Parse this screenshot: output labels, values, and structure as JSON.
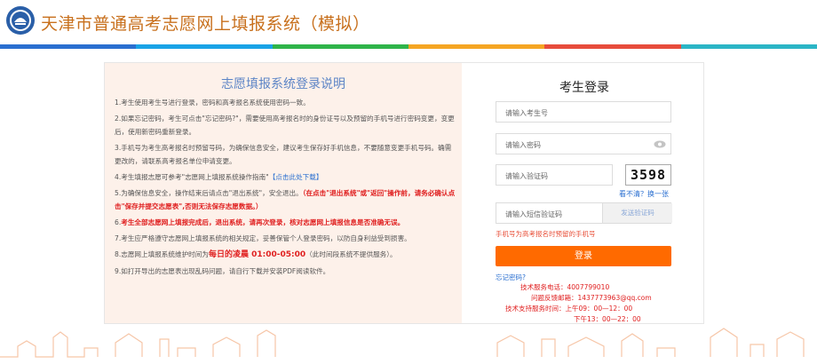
{
  "header": {
    "title": "天津市普通高考志愿网上填报系统（模拟）"
  },
  "colors": {
    "bar": [
      "#2a6fd0",
      "#1aa3e6",
      "#2fb44a",
      "#f5a623",
      "#e74c3c",
      "#2bb5c6"
    ],
    "accent": "#ff6a00"
  },
  "instructions": {
    "title": "志愿填报系统登录说明",
    "items": {
      "i1": "1.考生使用考生号进行登录，密码和高考报名系统使用密码一致。",
      "i2": "2.如果忘记密码，考生可点击\"忘记密码?\"，需要使用高考报名时的身份证号以及预留的手机号进行密码变更，变更后，使用新密码重新登录。",
      "i3": "3.手机号为考生高考报名时预留号码，为确保信息安全，建议考生保存好手机信息，不要随意变更手机号码。确需更改的，请联系高考报名单位申请变更。",
      "i4a": "4.考生填报志愿可参考\"志愿网上填报系统操作指南\"",
      "i4link": "【点击此处下载】",
      "i5a": "5.为确保信息安全，操作结束后请点击\"退出系统\"，安全退出。",
      "i5b": "（在点击\"退出系统\"或\"返回\"操作前，请务必确认点击\"保存并提交志愿表\",否则无法保存志愿数据。）",
      "i6a": "6.",
      "i6b": "考生全部志愿网上填报完成后，退出系统，请再次登录，核对志愿网上填报信息是否准确无误。",
      "i7": "7.考生应严格遵守志愿网上填报系统的相关规定，妥善保管个人登录密码，以防自身利益受到损害。",
      "i8a": "8.志愿网上填报系统维护时间为",
      "i8b": "每日的凌晨 01:00-05:00",
      "i8c": "（此时间段系统不提供服务）。",
      "i9": "9.如打开导出的志愿表出现乱码问题，请自行下载并安装PDF阅读软件。"
    }
  },
  "login": {
    "title": "考生登录",
    "id_placeholder": "请输入考生号",
    "pwd_placeholder": "请输入密码",
    "captcha_placeholder": "请输入验证码",
    "captcha_text": "3598",
    "refresh": "看不清？换一张",
    "sms_placeholder": "请输入短信验证码",
    "send_sms": "发送验证码",
    "hint": "手机号为高考报名时预留的手机号",
    "submit": "登录",
    "forgot": "忘记密码?"
  },
  "support": {
    "phone": "技术服务电话：4007799010",
    "email": "问题反馈邮箱：1437773963@qq.com",
    "hours1": "技术支持服务时间：上午09：00—12：00",
    "hours2": "下午13：00—22：00"
  }
}
